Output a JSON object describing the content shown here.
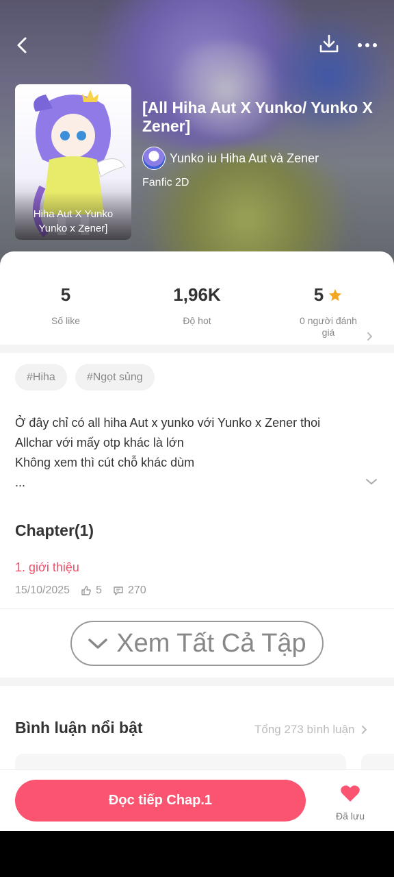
{
  "header": {
    "back_icon": "back-arrow-icon",
    "download_icon": "download-icon",
    "more_icon": "more-dots-icon"
  },
  "story": {
    "cover_caption": "Hiha Aut X Yunko Yunko x Zener]",
    "title": "[All Hiha Aut X Yunko/ Yunko X Zener]",
    "author": "Yunko iu Hiha Aut và Zener",
    "genre": "Fanfic 2D"
  },
  "stats": {
    "likes_value": "5",
    "likes_label": "Số like",
    "hot_value": "1,96K",
    "hot_label": "Độ hot",
    "rating_value": "5",
    "rating_label": "0 người đánh giá"
  },
  "tags": [
    "#Hiha",
    "#Ngọt sủng"
  ],
  "description": {
    "line1": "Ở đây chỉ có all hiha Aut x yunko với Yunko x Zener thoi",
    "line2": "Allchar với mấy otp khác là lớn",
    "line3": "Không xem thì cút chỗ khác dùm",
    "line4": "..."
  },
  "chapters": {
    "heading": "Chapter(1)",
    "items": [
      {
        "title": "1. giới thiệu",
        "date": "15/10/2025",
        "likes": "5",
        "comments": "270"
      }
    ],
    "see_all_label": "Xem Tất Cả Tập"
  },
  "comments": {
    "heading": "Bình luận nổi bật",
    "total_label": "Tổng 273 bình luận"
  },
  "bottom": {
    "read_label": "Đọc tiếp Chap.1",
    "saved_label": "Đã lưu"
  },
  "colors": {
    "accent": "#fa5470",
    "chapter_link": "#f24e6a",
    "star": "#f5a623"
  }
}
